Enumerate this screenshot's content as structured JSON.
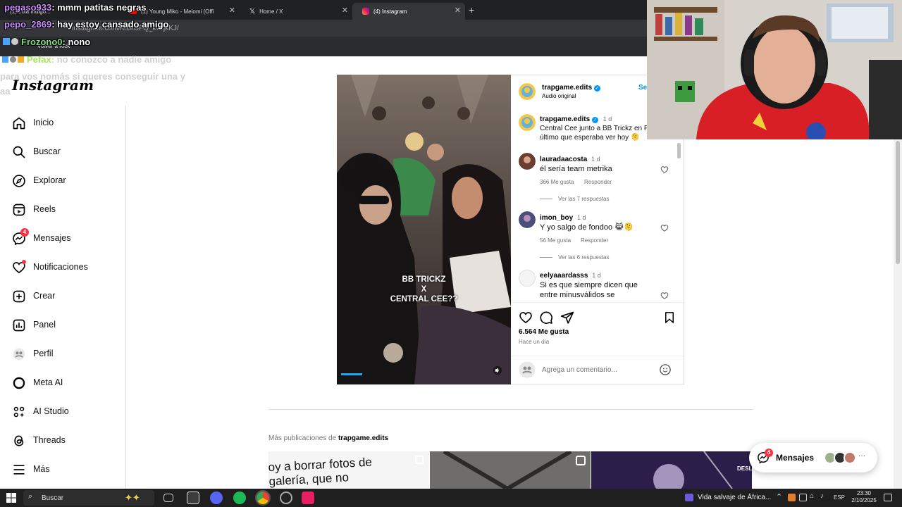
{
  "browser": {
    "tabs": [
      {
        "title": "(1) Lola Índigo...",
        "active": false
      },
      {
        "title": "(1) Young Miko - Meiomi (Offi",
        "active": false
      },
      {
        "title": "Home / X",
        "active": false
      },
      {
        "title": "(4) Instagram",
        "active": true
      }
    ],
    "new_tab": "+",
    "url": "instagram.com/reel/DFQ_kv9jkKJ/",
    "bookmark": "Volver a Kick"
  },
  "chat": [
    {
      "user": "pegaso933",
      "text": ": mmm patitas negras"
    },
    {
      "user": "pepo_2869",
      "text": ": hay estoy cansado amigo"
    },
    {
      "user": "Frozono0",
      "text": ": nono"
    },
    {
      "user": "Pefax",
      "text": ": no conozco a nadie amigo"
    },
    {
      "user": "",
      "text": "para vos nomás si queres conseguir una y"
    },
    {
      "user": "",
      "text": "aa"
    }
  ],
  "sidebar": {
    "logo": "Instagram",
    "items": [
      {
        "label": "Inicio",
        "icon": "home-icon"
      },
      {
        "label": "Buscar",
        "icon": "search-icon"
      },
      {
        "label": "Explorar",
        "icon": "compass-icon"
      },
      {
        "label": "Reels",
        "icon": "reels-icon"
      },
      {
        "label": "Mensajes",
        "icon": "messenger-icon",
        "badge": "4"
      },
      {
        "label": "Notificaciones",
        "icon": "heart-icon",
        "dot": true
      },
      {
        "label": "Crear",
        "icon": "plus-square-icon"
      },
      {
        "label": "Panel",
        "icon": "chart-icon"
      },
      {
        "label": "Perfil",
        "icon": "profile-avatar-icon"
      },
      {
        "label": "Meta AI",
        "icon": "meta-ai-ring-icon"
      },
      {
        "label": "AI Studio",
        "icon": "ai-studio-icon"
      },
      {
        "label": "Threads",
        "icon": "threads-icon"
      },
      {
        "label": "Más",
        "icon": "menu-icon"
      }
    ]
  },
  "post": {
    "overlay_text": [
      "BB TRICKZ",
      "X",
      "CENTRAL CEE??"
    ],
    "author": "trapgame.edits",
    "audio": "Audio original",
    "follow": "Se",
    "caption": {
      "user": "trapgame.edits",
      "time": "1 d",
      "text_line1": "Central Cee junto a BB Trickz en P",
      "text_line2": "último que esperaba ver hoy 🫠"
    },
    "comments": [
      {
        "user": "lauradaacosta",
        "time": "1 d",
        "text": "él sería team metrika",
        "likes": "366 Me gusta",
        "reply": "Responder",
        "view_replies": "Ver las 7 respuestas"
      },
      {
        "user": "imon_boy",
        "time": "1 d",
        "text": "Y yo salgo de fondoo 😹🫠",
        "likes": "56 Me gusta",
        "reply": "Responder",
        "view_replies": "Ver las 6 respuestas"
      },
      {
        "user": "eelyaaardasss",
        "time": "1 d",
        "text_line1": "Si es que siempre dicen que",
        "text_line2": "entre minusválidos se"
      }
    ],
    "likes": "6.564 Me gusta",
    "posted": "Hace un día",
    "comment_placeholder": "Agrega un comentario..."
  },
  "more_posts": {
    "label": "Más publicaciones de",
    "user": "trapgame.edits",
    "thumb1_text": "oy a borrar fotos de galería, que no",
    "thumb3_text": "DESL"
  },
  "messages_pill": {
    "label": "Mensajes",
    "badge": "4",
    "more": "···"
  },
  "taskbar": {
    "search": "Buscar",
    "news": "Vida salvaje de África...",
    "lang": "ESP",
    "time": "23:30",
    "date": "2/10/2025"
  },
  "colors": {
    "badge": "#ff3040",
    "verified": "#0095f6",
    "sidebar_border": "#dbdbdb"
  }
}
